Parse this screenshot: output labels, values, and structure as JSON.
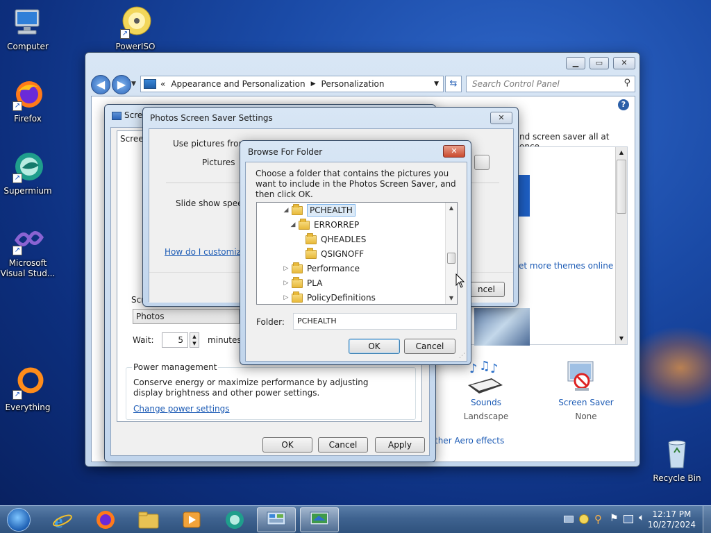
{
  "desktop": {
    "icons": [
      {
        "label": "Computer"
      },
      {
        "label": "PowerISO"
      },
      {
        "label": "Firefox"
      },
      {
        "label": "Supermium"
      },
      {
        "label": "Microsoft Visual Stud..."
      },
      {
        "label": "Everything"
      },
      {
        "label": "Recycle Bin"
      }
    ]
  },
  "control_panel": {
    "breadcrumb_prefix": "«",
    "breadcrumb": [
      "Appearance and Personalization",
      "Personalization"
    ],
    "search_placeholder": "Search Control Panel",
    "right_text_top": "nd screen saver all at once.",
    "more_themes_link": "et more themes online",
    "sounds_label": "Sounds",
    "sounds_sub": "Landscape",
    "screensaver_label": "Screen Saver",
    "screensaver_sub": "None",
    "aero_link": "ther Aero effects"
  },
  "screen_saver_settings": {
    "title": "Scre",
    "tab_label": "Screen",
    "group_label": "Scr",
    "selected_saver": "Photos",
    "wait_label": "Wait:",
    "wait_value": "5",
    "minutes_label": "minutes",
    "power_group_label": "Power management",
    "power_text": "Conserve energy or maximize performance by adjusting display brightness and other power settings.",
    "power_link": "Change power settings",
    "ok_label": "OK",
    "cancel_label": "Cancel",
    "apply_label": "Apply"
  },
  "photos_settings": {
    "title": "Photos Screen Saver Settings",
    "use_pictures_label": "Use pictures from:",
    "pictures_label": "Pictures",
    "slide_speed_label": "Slide show speed:",
    "customize_link": "How do I customize",
    "cancel_partial": "ncel"
  },
  "browse_folder": {
    "title": "Browse For Folder",
    "instructions": "Choose a folder that contains the pictures you want to include in the Photos Screen Saver, and then click OK.",
    "tree": [
      {
        "label": "PCHEALTH",
        "state": "expanded",
        "selected": true
      },
      {
        "label": "ERRORREP",
        "state": "expanded"
      },
      {
        "label": "QHEADLES",
        "state": "none"
      },
      {
        "label": "QSIGNOFF",
        "state": "none"
      },
      {
        "label": "Performance",
        "state": "collapsed"
      },
      {
        "label": "PLA",
        "state": "collapsed"
      },
      {
        "label": "PolicyDefinitions",
        "state": "collapsed"
      }
    ],
    "folder_label": "Folder:",
    "folder_value": "PCHEALTH",
    "ok_label": "OK",
    "cancel_label": "Cancel",
    "close_glyph": "✕"
  },
  "taskbar": {
    "time": "12:17 PM",
    "date": "10/27/2024"
  }
}
